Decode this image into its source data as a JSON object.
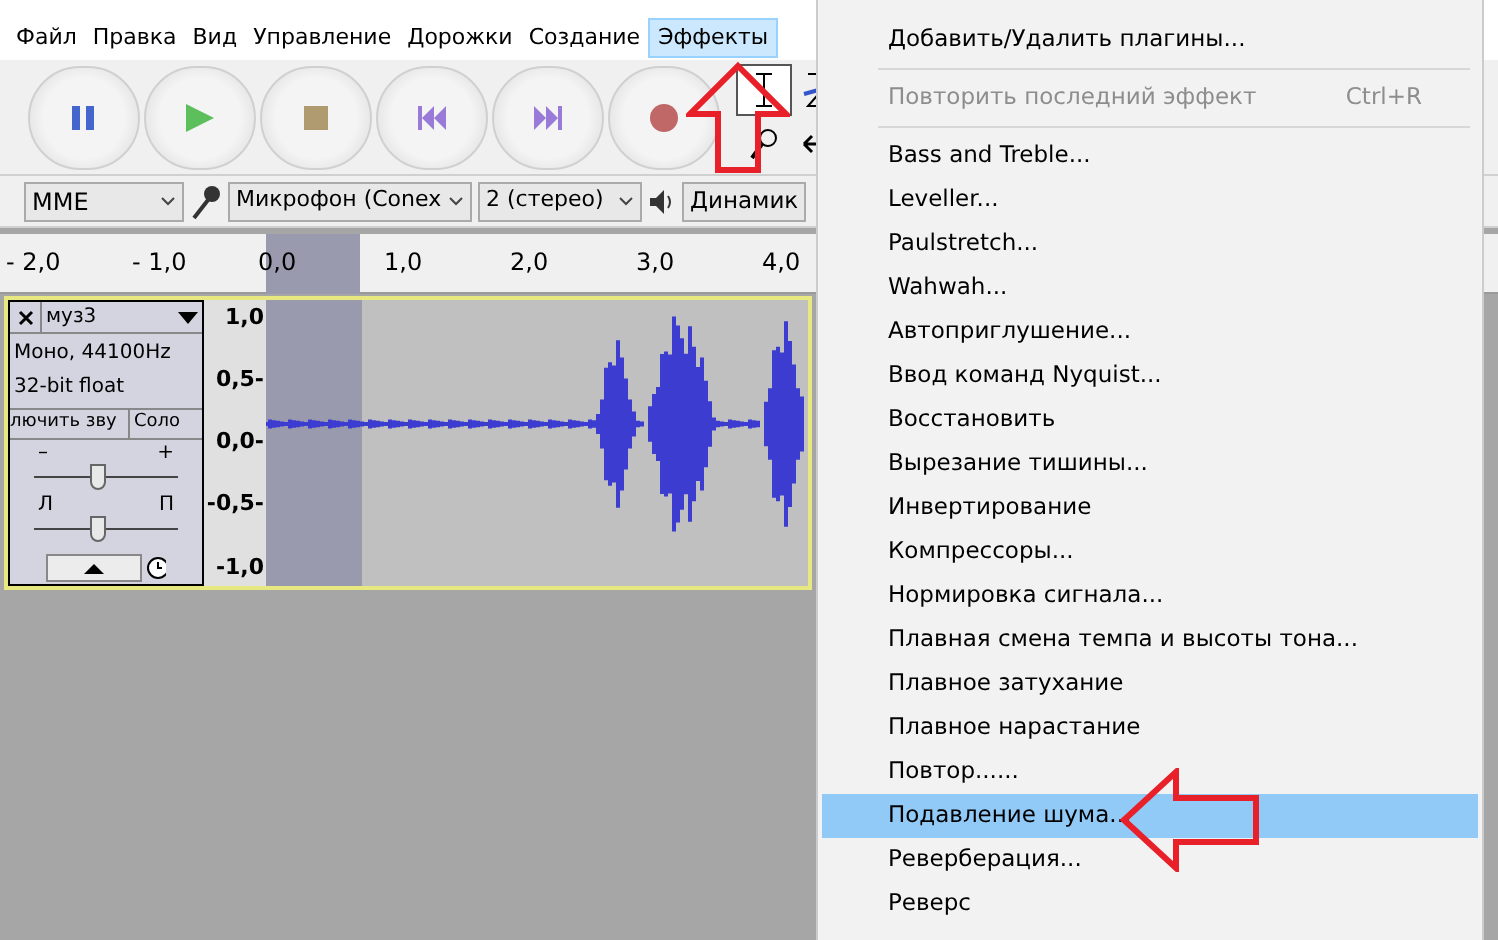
{
  "menu_bar": [
    {
      "label": "Файл",
      "selected": false
    },
    {
      "label": "Правка",
      "selected": false
    },
    {
      "label": "Вид",
      "selected": false
    },
    {
      "label": "Управление",
      "selected": false
    },
    {
      "label": "Дорожки",
      "selected": false
    },
    {
      "label": "Создание",
      "selected": false
    },
    {
      "label": "Эффекты",
      "selected": true
    }
  ],
  "device_toolbar": {
    "host": "MME",
    "input": "Микрофон (Conex",
    "channels": "2 (стерео)",
    "output": "Динамик"
  },
  "ruler": {
    "ticks": [
      "- 2,0",
      "- 1,0",
      "0,0",
      "1,0",
      "2,0",
      "3,0",
      "4,0"
    ]
  },
  "track": {
    "name": "муз3",
    "format": "Моно, 44100Hz",
    "bit_depth": "32-bit float",
    "mute_button": "лючить зву",
    "solo_button": "Соло",
    "gain": {
      "minus": "–",
      "plus": "+",
      "level": 0.45
    },
    "pan": {
      "left": "Л",
      "right": "П",
      "level": 0.45
    },
    "scale": [
      "1,0",
      "0,5-",
      "0,0-",
      "-0,5-",
      "-1,0"
    ]
  },
  "effects_menu": [
    {
      "label": "Добавить/Удалить плагины...",
      "kind": "item",
      "disabled": false,
      "selected": false
    },
    {
      "kind": "separator"
    },
    {
      "label": "Повторить последний эффект",
      "shortcut": "Ctrl+R",
      "kind": "item",
      "disabled": true,
      "selected": false
    },
    {
      "kind": "separator"
    },
    {
      "label": "Bass and Treble...",
      "kind": "item",
      "disabled": false,
      "selected": false
    },
    {
      "label": "Leveller...",
      "kind": "item",
      "disabled": false,
      "selected": false
    },
    {
      "label": "Paulstretch...",
      "kind": "item",
      "disabled": false,
      "selected": false
    },
    {
      "label": "Wahwah...",
      "kind": "item",
      "disabled": false,
      "selected": false
    },
    {
      "label": "Автоприглушение...",
      "kind": "item",
      "disabled": false,
      "selected": false
    },
    {
      "label": "Ввод команд Nyquist...",
      "kind": "item",
      "disabled": false,
      "selected": false
    },
    {
      "label": "Восстановить",
      "kind": "item",
      "disabled": false,
      "selected": false
    },
    {
      "label": "Вырезание тишины...",
      "kind": "item",
      "disabled": false,
      "selected": false
    },
    {
      "label": "Инвертирование",
      "kind": "item",
      "disabled": false,
      "selected": false
    },
    {
      "label": "Компрессоры...",
      "kind": "item",
      "disabled": false,
      "selected": false
    },
    {
      "label": "Нормировка сигнала...",
      "kind": "item",
      "disabled": false,
      "selected": false
    },
    {
      "label": "Плавная смена темпа и высоты тона...",
      "kind": "item",
      "disabled": false,
      "selected": false
    },
    {
      "label": "Плавное затухание",
      "kind": "item",
      "disabled": false,
      "selected": false
    },
    {
      "label": "Плавное нарастание",
      "kind": "item",
      "disabled": false,
      "selected": false
    },
    {
      "label": "Повтор......",
      "kind": "item",
      "disabled": false,
      "selected": false
    },
    {
      "label": "Подавление шума...",
      "kind": "item",
      "disabled": false,
      "selected": true
    },
    {
      "label": "Реверберация...",
      "kind": "item",
      "disabled": false,
      "selected": false
    },
    {
      "label": "Реверс",
      "kind": "item",
      "disabled": false,
      "selected": false
    }
  ]
}
